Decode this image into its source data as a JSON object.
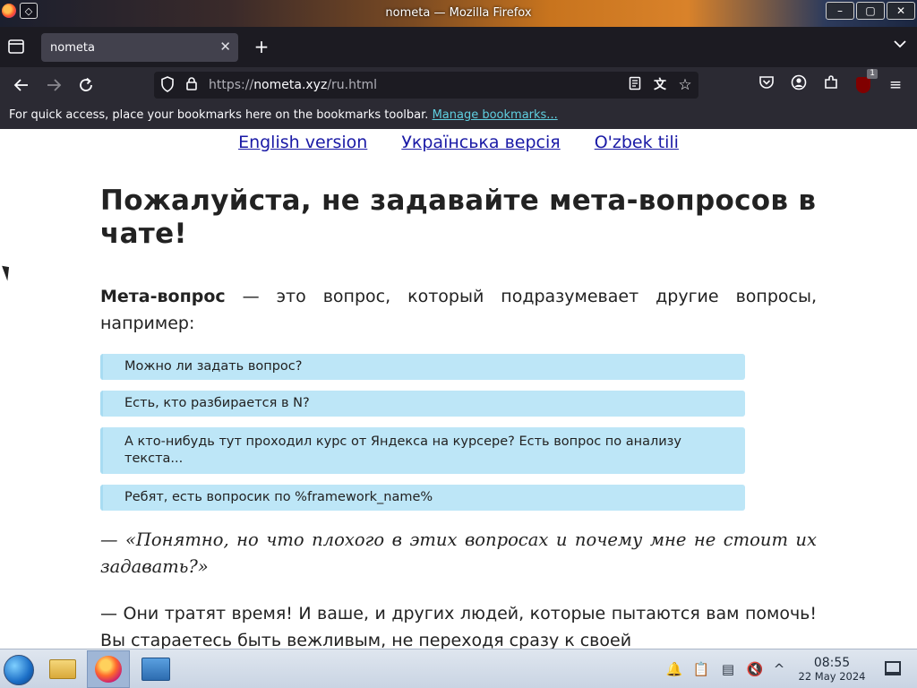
{
  "window": {
    "title": "nometa — Mozilla Firefox",
    "controls": {
      "minimize": "–",
      "maximize": "▢",
      "close": "✕"
    }
  },
  "tabs": [
    {
      "label": "nometa",
      "active": true
    }
  ],
  "toolbar": {
    "url_scheme": "https://",
    "url_host": "nometa.xyz",
    "url_path": "/ru.html",
    "extension_badge": "1"
  },
  "bookmarks_bar": {
    "message": "For quick access, place your bookmarks here on the bookmarks toolbar.",
    "link": "Manage bookmarks..."
  },
  "page": {
    "languages": [
      "English version",
      "Українська версія",
      "O'zbek tili"
    ],
    "heading": "Пожалуйста, не задавайте мета-вопросов в чате!",
    "intro_bold": "Мета-вопрос",
    "intro_rest": " — это вопрос, который подразумевает другие вопросы, например:",
    "examples": [
      "Можно ли задать вопрос?",
      "Есть, кто разбирается в N?",
      "А кто-нибудь тут проходил курс от Яндекса на курсере? Есть вопрос по анализу текста...",
      "Ребят, есть вопросик по %framework_name%"
    ],
    "quote": "— «Понятно, но что плохого в этих вопросах и почему мне не стоит их задавать?»",
    "answer": "— Они тратят время! И ваше, и других людей, которые пытаются вам помочь! Вы стараетесь быть вежливым, не переходя сразу к своей"
  },
  "taskbar": {
    "time": "08:55",
    "date": "22 May 2024"
  }
}
